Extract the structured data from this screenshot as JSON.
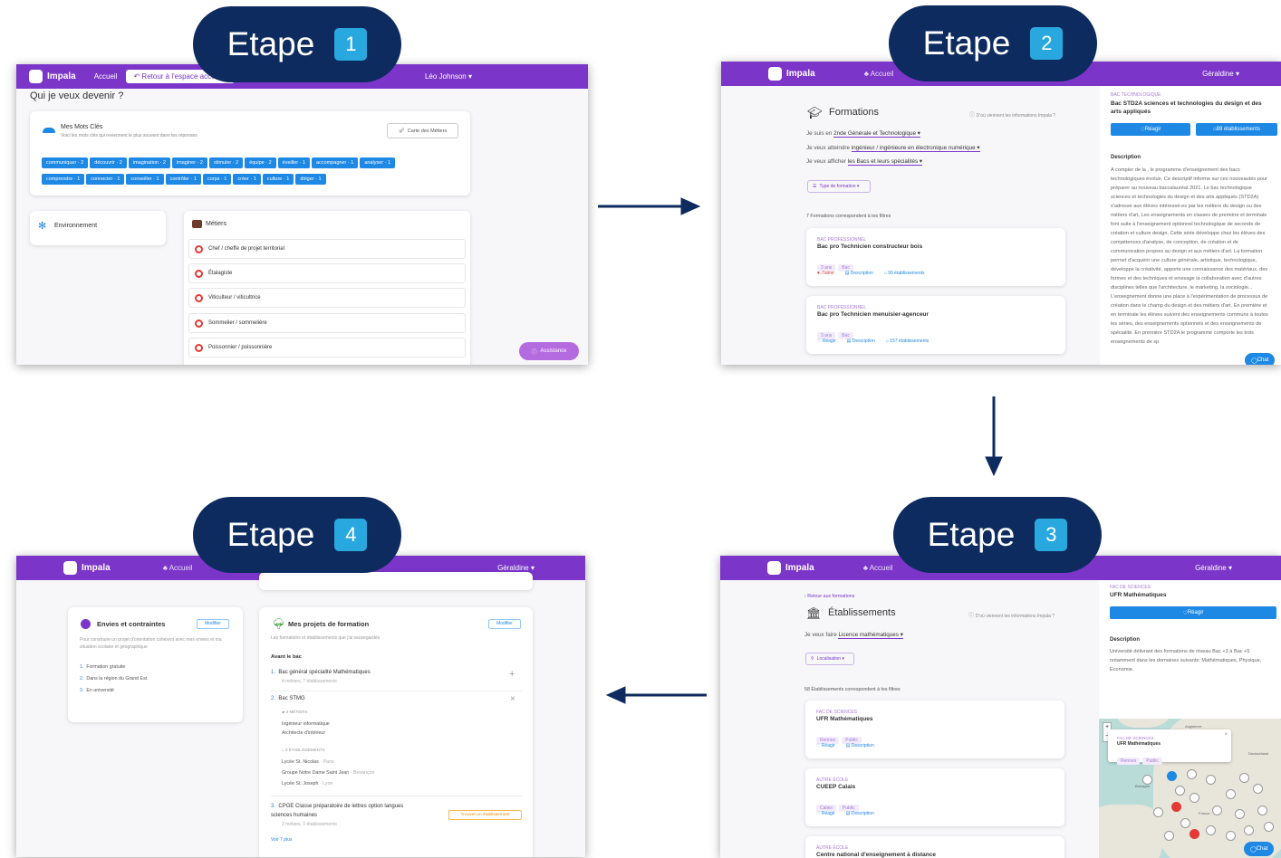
{
  "steps": [
    {
      "label": "Etape",
      "number": "1"
    },
    {
      "label": "Etape",
      "number": "2"
    },
    {
      "label": "Etape",
      "number": "3"
    },
    {
      "label": "Etape",
      "number": "4"
    }
  ],
  "shot1": {
    "brand": "Impala",
    "nav_home": "Accueil",
    "nav_back": "Retour à l'espace accom...",
    "user": "Léo Johnson ▾",
    "page_title": "Qui je veux devenir ?",
    "keywords_title": "Mes Mots Clés",
    "keywords_subtitle": "Voici les mots clés qui reviennent le plus souvent dans tes réponses",
    "keywords_button": "Carte des Métiers",
    "keywords_row1": [
      "communiquer · 2",
      "découvrir · 2",
      "imagination · 2",
      "imaginer · 2",
      "stimuler · 2",
      "équipe · 2",
      "éveiller · 1",
      "accompagner · 1",
      "analyser · 1"
    ],
    "keywords_row2": [
      "comprendre · 1",
      "connecter · 1",
      "conseiller · 1",
      "contrôler · 1",
      "corps · 1",
      "créer · 1",
      "culture · 1",
      "diriger · 1"
    ],
    "env_title": "Environnement",
    "metiers_title": "Métiers",
    "metiers": [
      "Chef / cheffe de projet territorial",
      "Étalagiste",
      "Viticulteur / viticultrice",
      "Sommelier / sommelière",
      "Poissonnier / poissonnière"
    ],
    "assistance": "Assistance"
  },
  "shot2": {
    "brand": "Impala",
    "nav_home": "Accueil",
    "user": "Géraldine ▾",
    "title": "Formations",
    "info": "D'où viennent les informations Impala ?",
    "line1_prefix": "Je suis en",
    "line1_value": "2nde Générale et Technologique ▾",
    "line2_prefix": "Je veux atteindre",
    "line2_value": "ingénieur / ingénieure en électronique numérique ▾",
    "line3_prefix": "Je veux afficher",
    "line3_value": "les Bacs et leurs spécialités ▾",
    "filter": "Type de formation ▾",
    "count": "7 Formations correspondent à tes filtres",
    "results": [
      {
        "kind": "BAC PROFESSIONNEL",
        "name": "Bac pro Technicien constructeur bois",
        "t1": "3 ans",
        "t2": "Bac",
        "like": "J'aime",
        "desc": "Description",
        "etab": "90 établissements"
      },
      {
        "kind": "BAC PROFESSIONNEL",
        "name": "Bac pro Technicien menuisier-agenceur",
        "t1": "3 ans",
        "t2": "Bac",
        "like": "Réagir",
        "desc": "Description",
        "etab": "157 établissements"
      }
    ],
    "side_kind": "BAC TECHNOLOGIQUE",
    "side_title": "Bac STD2A sciences et technologies du design et des arts appliqués",
    "side_react": "Réagir",
    "side_etab": "89 établissements",
    "side_desc_title": "Description",
    "side_desc": "A compter de la , le programme d'enseignement des bacs technologiques évolue. Ce descriptif informe sur ces nouveautés pour préparer au nouveau baccalauréat 2021. Le bac technologique sciences et technologies du design et des arts appliqués (STD2A) s'adresse aux élèves intéressé-es par les métiers du design ou des métiers d'art. Les enseignements en classes de première et terminale font suite à l'enseignement optionnel technologique de seconde de création et culture design. Cette série développe chez les élèves des compétences d'analyse, de conception, de création et de communication propres au design et aux métiers d'art. La formation permet d'acquérir une culture générale, artistique, technologique, développe la créativité, apporte une connaissance des matériaux, des formes et des techniques et envisage la collaboration avec d'autres disciplines telles que l'architecture, le marketing, la sociologie... L'enseignement donne une place à l'expérimentation de processus de création dans le champ du design et des métiers d'art. En première et en terminale les élèves suivent des enseignements communs à toutes les séries, des enseignements optionnels et des enseignements de spécialité. En première STD2A le programme comporte les trois enseignements de sp",
    "chat": "Chat"
  },
  "shot3": {
    "brand": "Impala",
    "nav_home": "Accueil",
    "user": "Géraldine ▾",
    "back": "Retour aux formations",
    "title": "Établissements",
    "info": "D'où viennent les informations Impala ?",
    "line1_prefix": "Je veux faire",
    "line1_value": "Licence mathématiques ▾",
    "filter": "Localisation ▾",
    "count": "58 Établissements correspondent à tes filtres",
    "results": [
      {
        "kind": "FAC DE SCIENCES",
        "name": "UFR Mathématiques",
        "t1": "Rennes",
        "t2": "Public",
        "react": "Réagir",
        "desc": "Description"
      },
      {
        "kind": "AUTRE ÉCOLE",
        "name": "CUEEP Calais",
        "t1": "Calais",
        "t2": "Public",
        "react": "Réagir",
        "desc": "Description"
      },
      {
        "kind": "AUTRE ÉCOLE",
        "name": "Centre national d'enseignement à distance"
      }
    ],
    "side_kind": "FAC DE SCIENCES",
    "side_title": "UFR Mathématiques",
    "side_react": "Réagir",
    "side_desc_title": "Description",
    "side_desc": "Université délivrant des formations de niveau Bac +3 à Bac +5 notamment dans les domaines suivants: Mathématiques, Physique, Économie.",
    "map_popup_kind": "FAC DE SCIENCES",
    "map_popup_title": "UFR Mathématiques",
    "map_popup_t1": "Rennes",
    "map_popup_t2": "Public",
    "map_labels": [
      "Angleterre",
      "Bretagne",
      "Deutschland",
      "France"
    ],
    "chat": "Chat"
  },
  "shot4": {
    "brand": "Impala",
    "nav_home": "Accueil",
    "user": "Géraldine ▾",
    "left_title": "Envies et contraintes",
    "left_button": "Modifier",
    "left_subtitle": "Pour construire un projet d'orientation cohérent avec mes envies et ma situation scolaire et géographique",
    "left_items": [
      "Formation gratuite",
      "Dans la région du Grand Est",
      "En université"
    ],
    "right_title": "Mes projets de formation",
    "right_button": "Modifier",
    "right_subtitle": "Les formations et établissements que j'ai sauvegardés",
    "section": "Avant le bac",
    "p1_title": "Bac général spécialité Mathématiques",
    "p1_meta": "4 métiers, 7 établissements",
    "p2_title": "Bac STMG",
    "p2_metiers_head": "2 MÉTIERS",
    "p2_metiers": [
      "Ingénieur informatique",
      "Architecte d'intérieur"
    ],
    "p2_etab_head": "3 ÉTABLISSEMENTS",
    "p2_etabs": [
      {
        "name": "Lycée St. Nicolas",
        "city": "· Paris"
      },
      {
        "name": "Groupe Notre Dame Saint Jean",
        "city": "· Besançon"
      },
      {
        "name": "Lycée St. Joseph",
        "city": "· Lyon"
      }
    ],
    "p3_title": "CPGE Classe préparatoire de lettres option langues sciences humaines",
    "p3_meta": "2 métiers, 0 établissements",
    "p3_button": "Trouver un établissement",
    "more": "Voir 7 plus"
  },
  "colors": {
    "navy": "#0d2b5e",
    "accent": "#29a8e0",
    "purple": "#7b35c9",
    "blue": "#1e88e5"
  }
}
